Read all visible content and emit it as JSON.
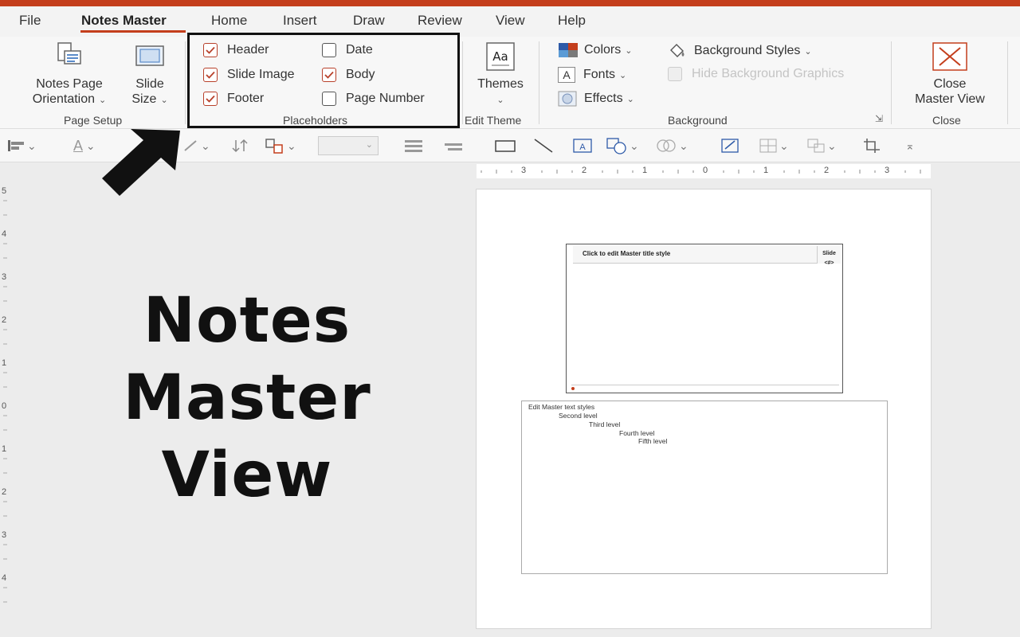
{
  "menu": {
    "file": "File",
    "notes_master": "Notes Master",
    "home": "Home",
    "insert": "Insert",
    "draw": "Draw",
    "review": "Review",
    "view": "View",
    "help": "Help"
  },
  "page_setup": {
    "orientation_line1": "Notes Page",
    "orientation_line2": "Orientation",
    "slide_size_line1": "Slide",
    "slide_size_line2": "Size",
    "group_label": "Page Setup"
  },
  "placeholders": {
    "header": "Header",
    "slide_image": "Slide Image",
    "footer": "Footer",
    "date": "Date",
    "body": "Body",
    "page_number": "Page Number",
    "group_label": "Placeholders",
    "checked": {
      "header": true,
      "slide_image": true,
      "footer": true,
      "date": false,
      "body": true,
      "page_number": false
    }
  },
  "edit_theme": {
    "themes": "Themes",
    "group_label": "Edit Theme"
  },
  "background": {
    "colors": "Colors",
    "fonts": "Fonts",
    "effects": "Effects",
    "background_styles": "Background Styles",
    "hide_background_graphics": "Hide Background Graphics",
    "group_label": "Background"
  },
  "close": {
    "line1": "Close",
    "line2": "Master View",
    "group_label": "Close"
  },
  "ruler": {
    "h_labels": [
      "3",
      "2",
      "1",
      "0",
      "1",
      "2",
      "3"
    ],
    "v_labels": [
      "5",
      "4",
      "3",
      "2",
      "1",
      "0",
      "1",
      "2",
      "3",
      "4"
    ]
  },
  "slide_thumb": {
    "title": "Click to edit Master title style",
    "corner_line1": "Slide",
    "corner_line2": "<#>"
  },
  "notes": {
    "level1": "Edit Master text styles",
    "level2": "Second level",
    "level3": "Third level",
    "level4": "Fourth level",
    "level5": "Fifth level"
  },
  "overlay": {
    "line1": "Notes",
    "line2": "Master",
    "line3": "View"
  },
  "colors": {
    "accent": "#c43e1c",
    "check_red": "#b8412b"
  }
}
